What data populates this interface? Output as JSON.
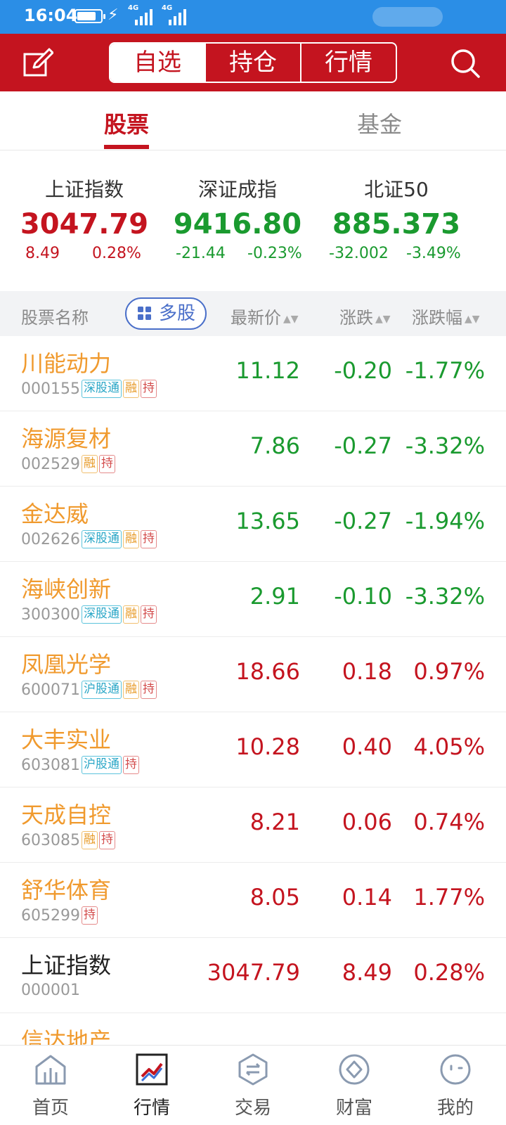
{
  "status": {
    "time": "16:04",
    "battery_level": 0.8,
    "net1": "4G",
    "net2": "4G"
  },
  "topbar": {
    "tabs": [
      "自选",
      "持仓",
      "行情"
    ],
    "active_tab": 0
  },
  "category_tabs": [
    {
      "label": "股票",
      "active": true
    },
    {
      "label": "基金",
      "active": false
    }
  ],
  "indices": [
    {
      "name": "上证指数",
      "value": "3047.79",
      "change": "8.49",
      "pct": "0.28%",
      "trend": "up"
    },
    {
      "name": "深证成指",
      "value": "9416.80",
      "change": "-21.44",
      "pct": "-0.23%",
      "trend": "down"
    },
    {
      "name": "北证50",
      "value": "885.373",
      "change": "-32.002",
      "pct": "-3.49%",
      "trend": "down"
    }
  ],
  "table_header": {
    "name": "股票名称",
    "multi": "多股",
    "price": "最新价",
    "change": "涨跌",
    "pct": "涨跌幅"
  },
  "rows": [
    {
      "name": "川能动力",
      "code": "000155",
      "badges": [
        "深股通",
        "融",
        "持"
      ],
      "price": "11.12",
      "change": "-0.20",
      "pct": "-1.77%",
      "trend": "down"
    },
    {
      "name": "海源复材",
      "code": "002529",
      "badges": [
        "融",
        "持"
      ],
      "price": "7.86",
      "change": "-0.27",
      "pct": "-3.32%",
      "trend": "down"
    },
    {
      "name": "金达威",
      "code": "002626",
      "badges": [
        "深股通",
        "融",
        "持"
      ],
      "price": "13.65",
      "change": "-0.27",
      "pct": "-1.94%",
      "trend": "down"
    },
    {
      "name": "海峡创新",
      "code": "300300",
      "badges": [
        "深股通",
        "融",
        "持"
      ],
      "price": "2.91",
      "change": "-0.10",
      "pct": "-3.32%",
      "trend": "down"
    },
    {
      "name": "凤凰光学",
      "code": "600071",
      "badges": [
        "沪股通",
        "融",
        "持"
      ],
      "price": "18.66",
      "change": "0.18",
      "pct": "0.97%",
      "trend": "up"
    },
    {
      "name": "大丰实业",
      "code": "603081",
      "badges": [
        "沪股通",
        "持"
      ],
      "price": "10.28",
      "change": "0.40",
      "pct": "4.05%",
      "trend": "up"
    },
    {
      "name": "天成自控",
      "code": "603085",
      "badges": [
        "融",
        "持"
      ],
      "price": "8.21",
      "change": "0.06",
      "pct": "0.74%",
      "trend": "up"
    },
    {
      "name": "舒华体育",
      "code": "605299",
      "badges": [
        "持"
      ],
      "price": "8.05",
      "change": "0.14",
      "pct": "1.77%",
      "trend": "up"
    },
    {
      "name": "上证指数",
      "code": "000001",
      "badges": [],
      "price": "3047.79",
      "change": "8.49",
      "pct": "0.28%",
      "trend": "up",
      "index": true
    },
    {
      "name": "信达地产",
      "code": "",
      "badges": [],
      "price": "",
      "change": "",
      "pct": "",
      "trend": "up"
    }
  ],
  "bottom_nav": [
    {
      "label": "首页",
      "icon": "home-icon"
    },
    {
      "label": "行情",
      "icon": "chart-icon",
      "active": true
    },
    {
      "label": "交易",
      "icon": "exchange-icon"
    },
    {
      "label": "财富",
      "icon": "wealth-icon"
    },
    {
      "label": "我的",
      "icon": "profile-icon"
    }
  ],
  "colors": {
    "brand": "#c4141f",
    "up": "#c4141f",
    "down": "#1a9a2f",
    "status_bar": "#2b8ee6"
  }
}
